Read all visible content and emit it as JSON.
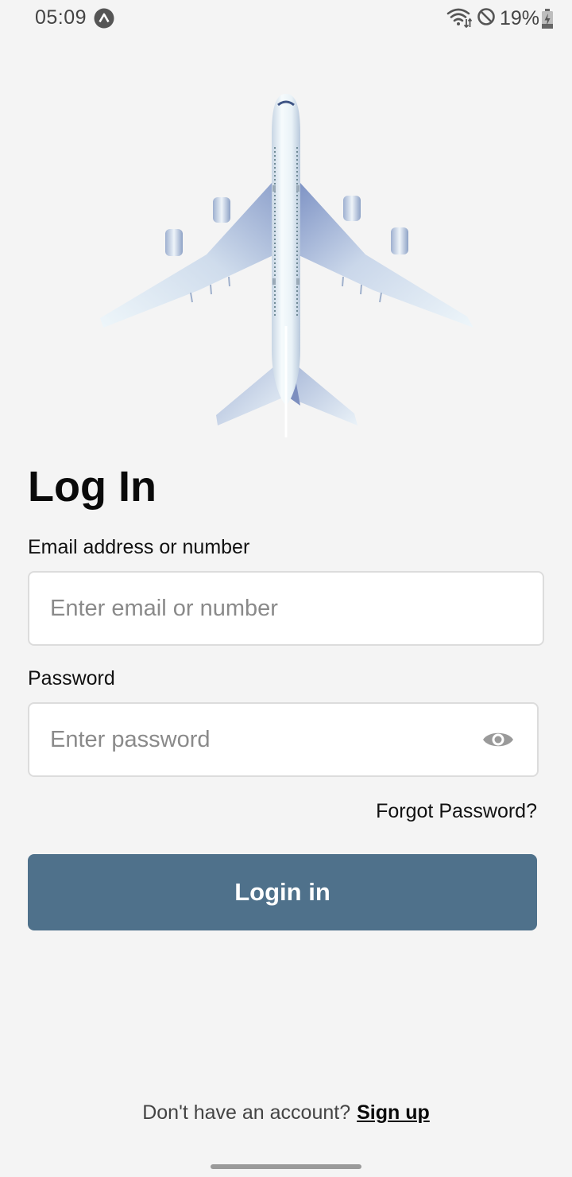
{
  "status_bar": {
    "time": "05:09",
    "battery_percent": "19%",
    "icons": [
      "app-notification-icon",
      "wifi-icon",
      "dnd-icon",
      "battery-icon"
    ]
  },
  "hero": {
    "icon": "airplane-illustration"
  },
  "page": {
    "title": "Log In"
  },
  "email_field": {
    "label": "Email address or number",
    "placeholder": "Enter email or number",
    "value": ""
  },
  "password_field": {
    "label": "Password",
    "placeholder": "Enter password",
    "value": "",
    "visibility_icon": "eye-icon"
  },
  "forgot_password": {
    "label": "Forgot Password?"
  },
  "login_button": {
    "label": "Login in"
  },
  "signup": {
    "prompt": "Don't have an account?",
    "link_label": "Sign up"
  },
  "colors": {
    "background": "#f4f4f4",
    "primary_button": "#4f718b",
    "input_background": "#ffffff",
    "input_border": "#dcdcdc",
    "placeholder": "#8a8a8a"
  }
}
